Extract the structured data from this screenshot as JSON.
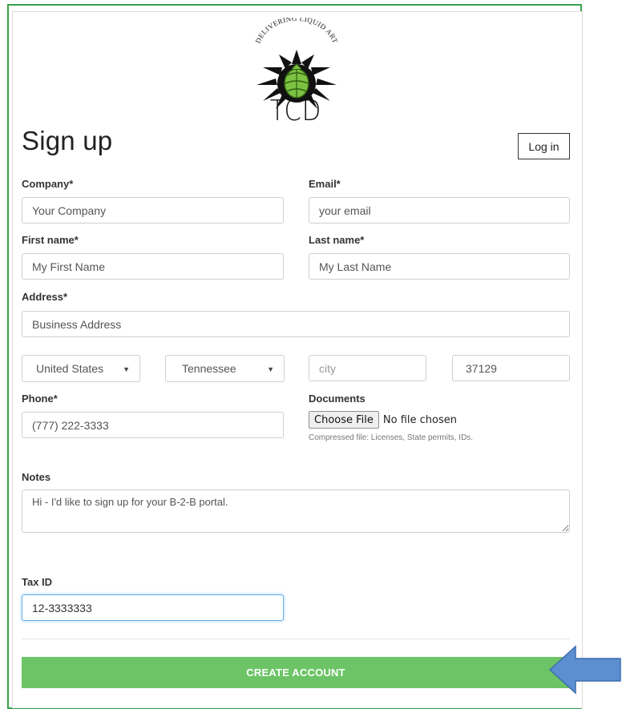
{
  "logo": {
    "tagline": "DELIVERING LIQUID ART",
    "wordmark": "TCD"
  },
  "page_title": "Sign up",
  "login_button": "Log in",
  "form": {
    "company": {
      "label": "Company*",
      "placeholder": "Your Company"
    },
    "email": {
      "label": "Email*",
      "placeholder": "your email"
    },
    "first_name": {
      "label": "First name*",
      "placeholder": "My First Name"
    },
    "last_name": {
      "label": "Last name*",
      "placeholder": "My Last Name"
    },
    "address": {
      "label": "Address*",
      "placeholder": "Business Address"
    },
    "country": {
      "value": "United States"
    },
    "state": {
      "value": "Tennessee"
    },
    "city": {
      "placeholder": "city"
    },
    "zip": {
      "value": "37129"
    },
    "phone": {
      "label": "Phone*",
      "value": "(777) 222-3333"
    },
    "documents": {
      "label": "Documents",
      "button": "Choose File",
      "status": "No file chosen",
      "help": "Compressed file: Licenses, State permits, IDs."
    },
    "notes": {
      "label": "Notes",
      "value": "Hi - I'd like to sign up for your B-2-B portal."
    },
    "tax_id": {
      "label": "Tax ID",
      "value": "12-3333333"
    }
  },
  "create_button": "CREATE ACCOUNT",
  "colors": {
    "frame": "#3aa14a",
    "create_button": "#6cc466",
    "arrow": "#5b8fd0"
  },
  "icons": [
    "chevron-down-icon",
    "arrow-left-icon",
    "hop-logo-icon"
  ]
}
